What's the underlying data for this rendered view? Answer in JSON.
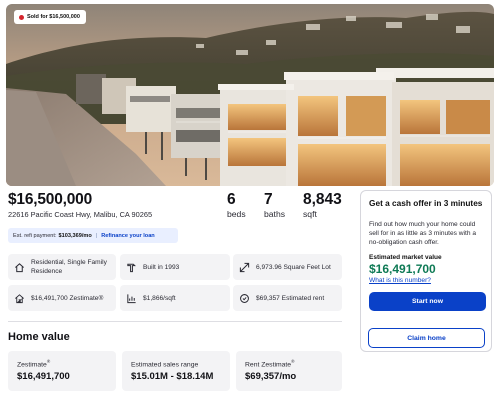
{
  "listing": {
    "sold_badge": "Sold for $16,500,000",
    "price": "$16,500,000",
    "address": "22616 Pacific Coast Hwy, Malibu, CA 90265",
    "beds": {
      "value": "6",
      "label": "beds"
    },
    "baths": {
      "value": "7",
      "label": "baths"
    },
    "sqft": {
      "value": "8,843",
      "label": "sqft"
    }
  },
  "refi": {
    "label": "Est. refi payment:",
    "amount": "$103,369/mo",
    "link": "Refinance your loan"
  },
  "facts": [
    {
      "icon": "house-icon",
      "text": "Residential, Single Family Residence"
    },
    {
      "icon": "hammer-icon",
      "text": "Built in 1993"
    },
    {
      "icon": "lot-size-icon",
      "text": "6,973.96 Square Feet Lot"
    },
    {
      "icon": "zestimate-icon",
      "text": "$16,491,700 Zestimate®"
    },
    {
      "icon": "price-per-sqft-icon",
      "text": "$1,866/sqft"
    },
    {
      "icon": "rent-icon",
      "text": "$69,357 Estimated rent"
    }
  ],
  "home_value": {
    "title": "Home value",
    "cards": [
      {
        "label": "Zestimate",
        "sup": "®",
        "value": "$16,491,700"
      },
      {
        "label": "Estimated sales range",
        "sup": "",
        "value": "$15.01M - $18.14M"
      },
      {
        "label": "Rent Zestimate",
        "sup": "®",
        "value": "$69,357/mo"
      }
    ]
  },
  "cash_offer": {
    "title": "Get a cash offer in 3 minutes",
    "text": "Find out how much your home could sell for in as little as 3 minutes with a no-obligation cash offer.",
    "estimate_label": "Estimated market value",
    "estimate_value": "$16,491,700",
    "question_link": "What is this number?",
    "start_button": "Start now",
    "claim_button": "Claim home"
  },
  "colors": {
    "brand_blue": "#0a41c8",
    "value_green": "#0e7a55",
    "sold_red": "#d4262e"
  }
}
